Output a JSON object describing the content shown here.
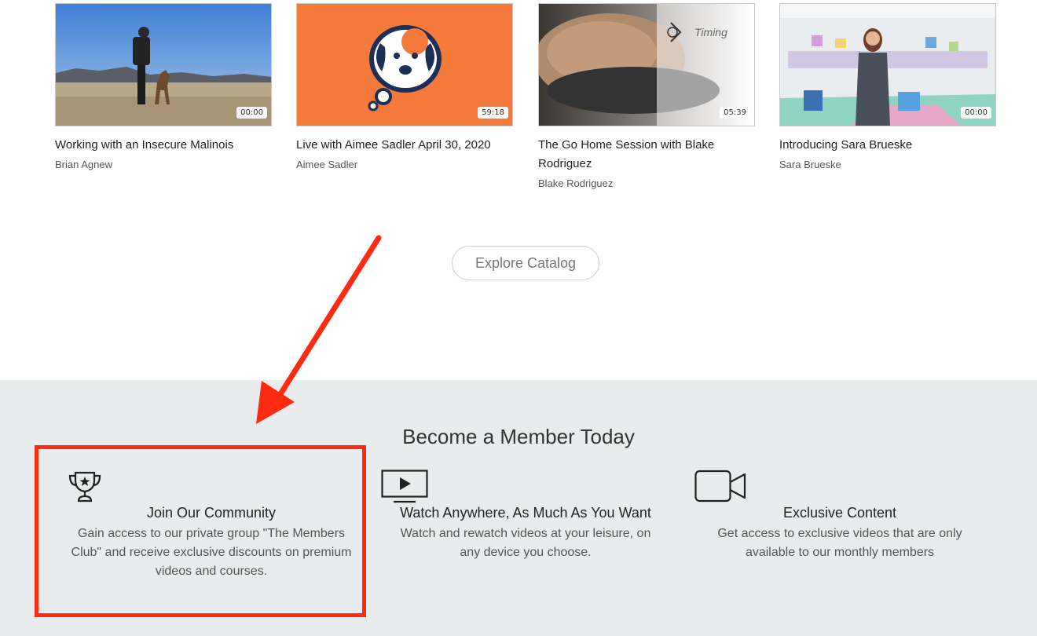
{
  "videos": [
    {
      "title": "Working with an Insecure Malinois",
      "author": "Brian Agnew",
      "duration": "00:00",
      "thumb": "field-dog-trainer"
    },
    {
      "title": "Live with Aimee Sadler April 30, 2020",
      "author": "Aimee Sadler",
      "duration": "59:18",
      "thumb": "orange-dog-logo"
    },
    {
      "title": "The Go Home Session with Blake Rodriguez",
      "author": "Blake Rodriguez",
      "duration": "05:39",
      "thumb": "food-bowl-timing",
      "overlay_label": "Timing"
    },
    {
      "title": "Introducing Sara Brueske",
      "author": "Sara Brueske",
      "duration": "00:00",
      "thumb": "woman-training-room"
    }
  ],
  "explore_label": "Explore Catalog",
  "member": {
    "title": "Become a Member Today",
    "features": [
      {
        "icon": "trophy-icon",
        "title": "Join Our Community",
        "desc": "Gain access to our private group \"The Members Club\" and receive exclusive discounts on premium videos and courses."
      },
      {
        "icon": "tv-play-icon",
        "title": "Watch Anywhere, As Much As You Want",
        "desc": "Watch and rewatch videos at your leisure, on any device you choose."
      },
      {
        "icon": "video-camera-icon",
        "title": "Exclusive Content",
        "desc": "Get access to exclusive videos that are only available to our monthly members"
      }
    ]
  },
  "colors": {
    "accent_orange": "#f47a3c",
    "highlight_red": "#ff2a12",
    "member_bg": "#e8ecec"
  }
}
